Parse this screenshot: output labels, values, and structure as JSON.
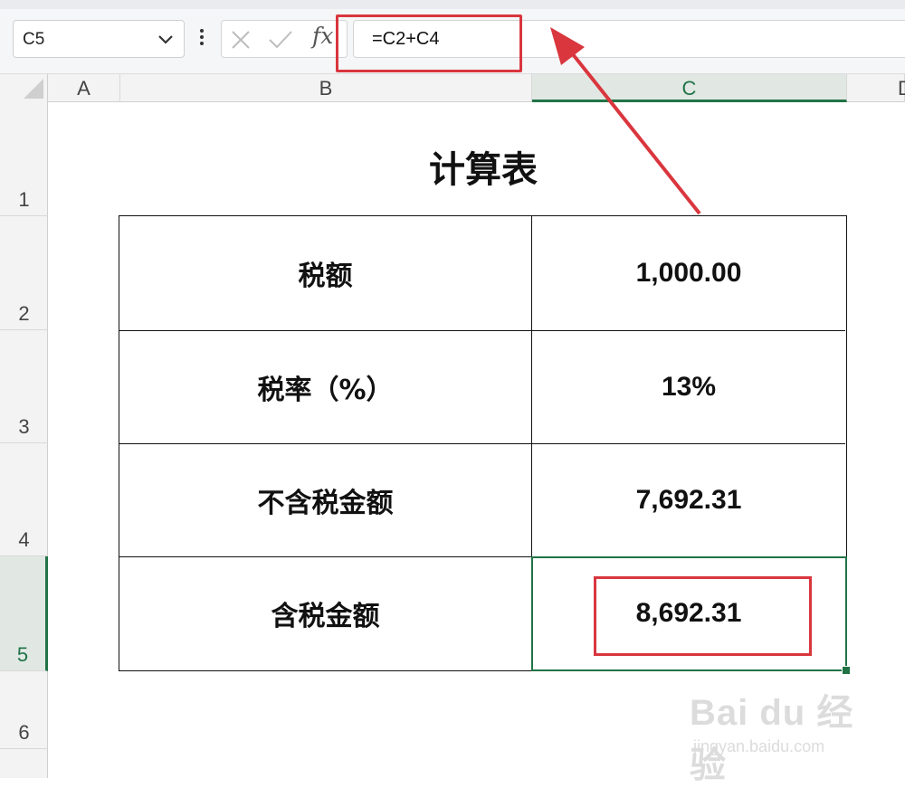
{
  "formula_bar": {
    "name_box": "C5",
    "formula": "=C2+C4",
    "fx_label": "fx"
  },
  "columns": [
    "A",
    "B",
    "C",
    "D"
  ],
  "rows": [
    "1",
    "2",
    "3",
    "4",
    "5",
    "6"
  ],
  "selected_cell": "C5",
  "sheet": {
    "title": "计算表",
    "table": [
      {
        "label": "税额",
        "value": "1,000.00"
      },
      {
        "label": "税率（%）",
        "value": "13%"
      },
      {
        "label": "不含税金额",
        "value": "7,692.31"
      },
      {
        "label": "含税金额",
        "value": "8,692.31"
      }
    ]
  },
  "watermark": {
    "logo": "Bai du 经验",
    "url": "jingyan.baidu.com"
  },
  "colors": {
    "accent_green": "#217346",
    "highlight_red": "#d9363e"
  }
}
